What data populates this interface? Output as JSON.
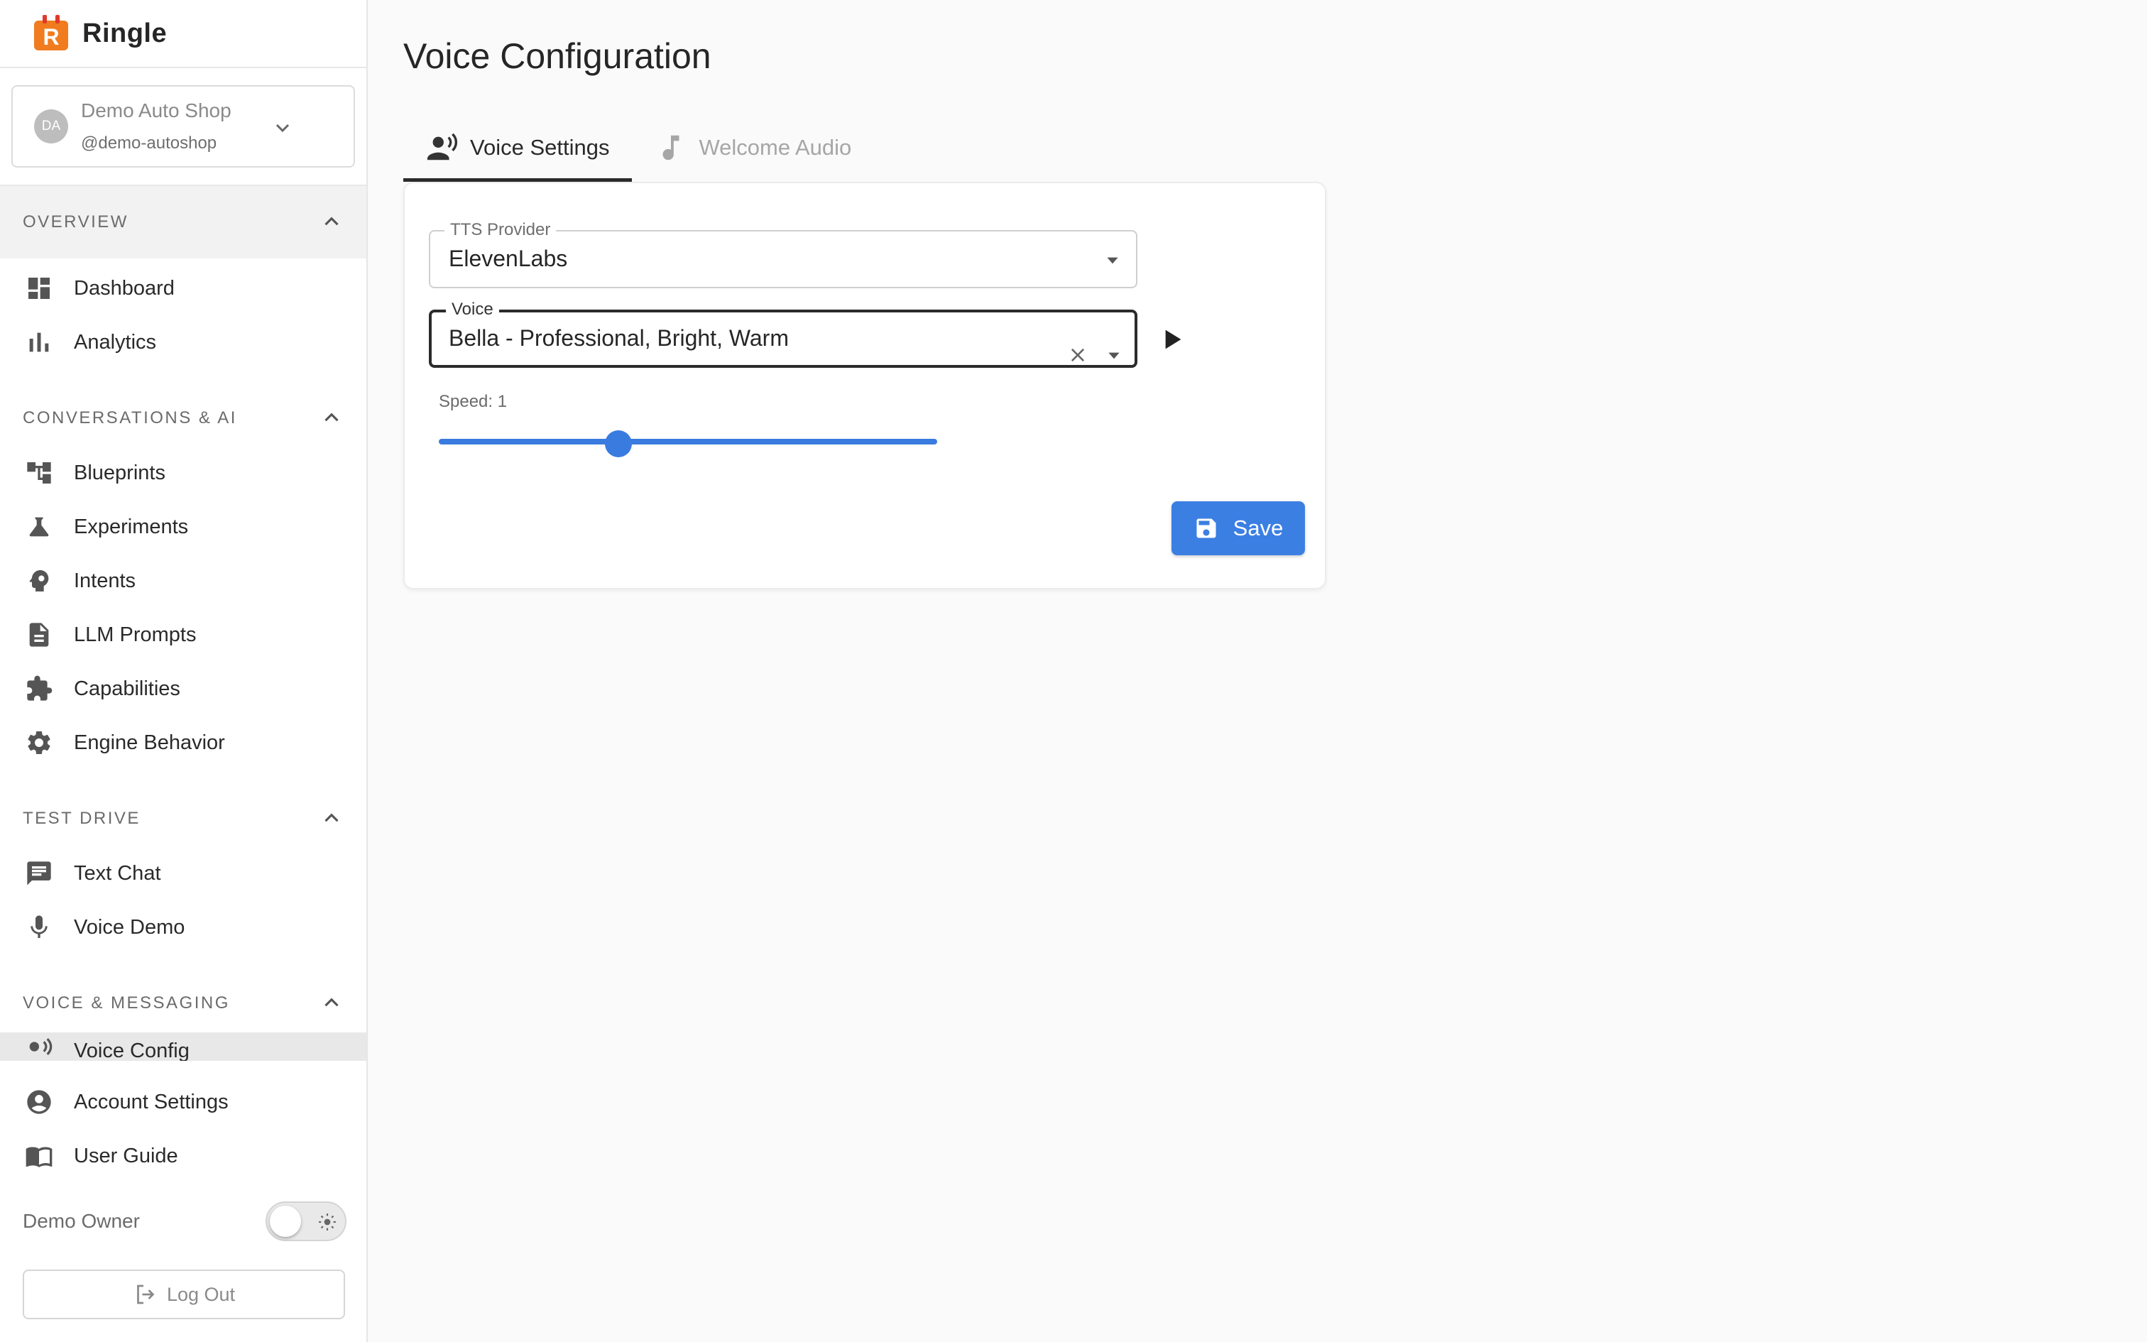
{
  "brand": {
    "name": "Ringle",
    "logo_letter": "R"
  },
  "org": {
    "initials": "DA",
    "name": "Demo Auto Shop",
    "handle": "@demo-autoshop"
  },
  "sections": {
    "overview": {
      "label": "OVERVIEW",
      "items": [
        {
          "label": "Dashboard",
          "icon": "dashboard-icon"
        },
        {
          "label": "Analytics",
          "icon": "bar-chart-icon"
        }
      ]
    },
    "conversations": {
      "label": "CONVERSATIONS & AI",
      "items": [
        {
          "label": "Blueprints",
          "icon": "flow-tree-icon"
        },
        {
          "label": "Experiments",
          "icon": "flask-icon"
        },
        {
          "label": "Intents",
          "icon": "brain-head-icon"
        },
        {
          "label": "LLM Prompts",
          "icon": "document-icon"
        },
        {
          "label": "Capabilities",
          "icon": "puzzle-icon"
        },
        {
          "label": "Engine Behavior",
          "icon": "gear-icon"
        }
      ]
    },
    "test_drive": {
      "label": "TEST DRIVE",
      "items": [
        {
          "label": "Text Chat",
          "icon": "chat-icon"
        },
        {
          "label": "Voice Demo",
          "icon": "microphone-icon"
        }
      ]
    },
    "voice_messaging": {
      "label": "VOICE & MESSAGING",
      "items": [
        {
          "label": "Voice Config",
          "icon": "voice-icon"
        }
      ]
    }
  },
  "footer_nav": [
    {
      "label": "Account Settings",
      "icon": "account-circle-icon"
    },
    {
      "label": "User Guide",
      "icon": "book-icon"
    }
  ],
  "owner": {
    "label": "Demo Owner"
  },
  "logout": {
    "label": "Log Out"
  },
  "page": {
    "title": "Voice Configuration",
    "tabs": [
      {
        "label": "Voice Settings",
        "icon": "voice-settings-icon",
        "active": true
      },
      {
        "label": "Welcome Audio",
        "icon": "music-note-icon",
        "active": false
      }
    ]
  },
  "form": {
    "tts_provider": {
      "label": "TTS Provider",
      "value": "ElevenLabs"
    },
    "voice": {
      "label": "Voice",
      "value": "Bella - Professional, Bright, Warm"
    },
    "speed": {
      "label": "Speed: 1",
      "value": 1
    },
    "save_label": "Save"
  },
  "colors": {
    "accent": "#3b7fe3",
    "logo": "#f07c1f"
  }
}
